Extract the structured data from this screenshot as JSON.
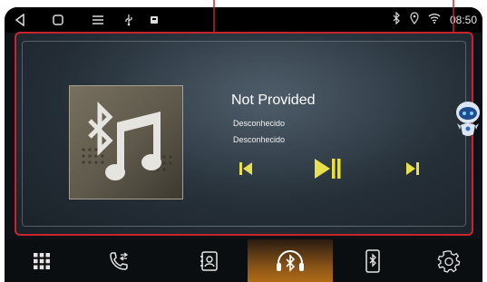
{
  "status_bar": {
    "time": "08:50",
    "left_icons": [
      "back-icon",
      "home-icon",
      "menu-icon",
      "usb-icon",
      "notification-icon"
    ],
    "right_icons": [
      "bluetooth-icon",
      "location-icon",
      "wifi-icon"
    ]
  },
  "now_playing": {
    "title": "Not Provided",
    "artist": "Desconhecido",
    "album": "Desconhecido",
    "art_icons": [
      "bluetooth-icon",
      "music-note-icon"
    ]
  },
  "controls": [
    "previous-track-icon",
    "play-pause-icon",
    "next-track-icon"
  ],
  "assistant": {
    "icon": "robot-assistant-icon"
  },
  "bottom_nav": {
    "items": [
      {
        "icon": "apps-grid-icon"
      },
      {
        "icon": "phone-icon"
      },
      {
        "icon": "contacts-icon"
      },
      {
        "icon": "bluetooth-headphones-icon"
      },
      {
        "icon": "phone-bluetooth-icon"
      },
      {
        "icon": "settings-bluetooth-icon"
      }
    ],
    "active_index": 3
  },
  "colors": {
    "highlight_border": "#c8242b",
    "active_tab": "#b06c17",
    "control_yellow": "#e8e04a"
  }
}
